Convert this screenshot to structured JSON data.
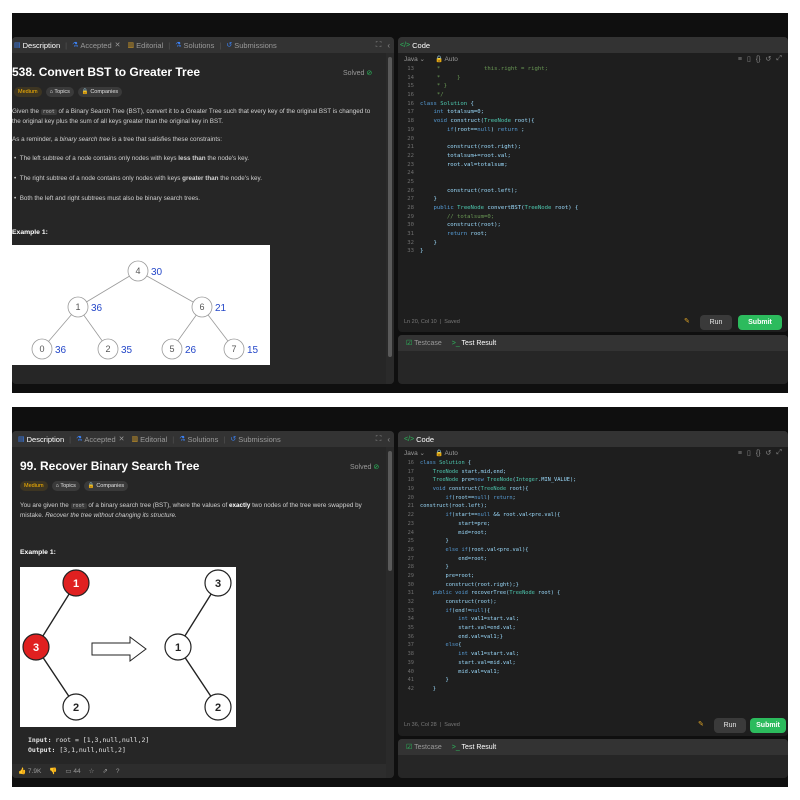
{
  "shots": [
    {
      "tabs": {
        "description": "Description",
        "accepted": "Accepted",
        "editorial": "Editorial",
        "solutions": "Solutions",
        "submissions": "Submissions"
      },
      "problem": {
        "title": "538. Convert BST to Greater Tree",
        "status": "Solved",
        "difficulty": "Medium",
        "topics": "Topics",
        "companies": "Companies",
        "p1a": "Given the",
        "p1code": "root",
        "p1b": "of a Binary Search Tree (BST), convert it to a Greater Tree such that every key of the original BST is changed to the original key plus the sum of all keys greater than the original key in BST.",
        "p2a": "As a reminder, a",
        "p2em": "binary search tree",
        "p2b": "is a tree that satisfies these constraints:",
        "b1a": "The left subtree of a node contains only nodes with keys",
        "b1b": "less than",
        "b1c": "the node's key.",
        "b2a": "The right subtree of a node contains only nodes with keys",
        "b2b": "greater than",
        "b2c": "the node's key.",
        "b3": "Both the left and right subtrees must also be binary search trees.",
        "example": "Example 1:"
      },
      "tree": {
        "nodes": [
          {
            "v": "4",
            "sum": "30"
          },
          {
            "v": "1",
            "sum": "36"
          },
          {
            "v": "6",
            "sum": "21"
          },
          {
            "v": "0",
            "sum": "36"
          },
          {
            "v": "2",
            "sum": "35"
          },
          {
            "v": "5",
            "sum": "26"
          },
          {
            "v": "7",
            "sum": "15"
          }
        ]
      },
      "editor": {
        "header": "Code",
        "lang": "Java",
        "mode": "Auto",
        "cursor": "Ln 20, Col 10",
        "saved": "Saved",
        "run": "Run",
        "submit": "Submit",
        "testcase": "Testcase",
        "testresult": "Test Result",
        "lines": [
          {
            "n": "13",
            "t": "     *             this.right = right;"
          },
          {
            "n": "14",
            "t": "     *     }"
          },
          {
            "n": "15",
            "t": "     * }"
          },
          {
            "n": "16",
            "t": "     */"
          },
          {
            "n": "16",
            "t": "class Solution {"
          },
          {
            "n": "17",
            "t": "    int totalsum=0;"
          },
          {
            "n": "18",
            "t": "    void construct(TreeNode root){"
          },
          {
            "n": "19",
            "t": "        if(root==null) return ;"
          },
          {
            "n": "20",
            "t": ""
          },
          {
            "n": "21",
            "t": "        construct(root.right);"
          },
          {
            "n": "22",
            "t": "        totalsum+=root.val;"
          },
          {
            "n": "23",
            "t": "        root.val=totalsum;"
          },
          {
            "n": "24",
            "t": ""
          },
          {
            "n": "25",
            "t": ""
          },
          {
            "n": "26",
            "t": "        construct(root.left);"
          },
          {
            "n": "27",
            "t": "    }"
          },
          {
            "n": "28",
            "t": "    public TreeNode convertBST(TreeNode root) {"
          },
          {
            "n": "29",
            "t": "        // totalsum=0;"
          },
          {
            "n": "30",
            "t": "        construct(root);"
          },
          {
            "n": "31",
            "t": "        return root;"
          },
          {
            "n": "32",
            "t": "    }"
          },
          {
            "n": "33",
            "t": "}"
          }
        ]
      }
    },
    {
      "tabs": {
        "description": "Description",
        "accepted": "Accepted",
        "editorial": "Editorial",
        "solutions": "Solutions",
        "submissions": "Submissions"
      },
      "problem": {
        "title": "99. Recover Binary Search Tree",
        "status": "Solved",
        "difficulty": "Medium",
        "topics": "Topics",
        "companies": "Companies",
        "p1a": "You are given the",
        "p1code": "root",
        "p1b": "of a binary search tree (BST), where the values of",
        "p1bold": "exactly",
        "p1c": "two nodes of the tree were swapped by mistake.",
        "p1em": "Recover the tree without changing its structure.",
        "example": "Example 1:",
        "input_label": "Input:",
        "input_value": "root = [1,3,null,null,2]",
        "output_label": "Output:",
        "output_value": "[3,1,null,null,2]",
        "likes": "7.9K",
        "comments": "44"
      },
      "tree": {
        "before": [
          "1",
          "3",
          "2"
        ],
        "after": [
          "3",
          "1",
          "2"
        ]
      },
      "editor": {
        "header": "Code",
        "lang": "Java",
        "mode": "Auto",
        "cursor": "Ln 36, Col 28",
        "saved": "Saved",
        "run": "Run",
        "submit": "Submit",
        "testcase": "Testcase",
        "testresult": "Test Result",
        "lines": [
          {
            "n": "16",
            "t": "class Solution {"
          },
          {
            "n": "17",
            "t": "    TreeNode start,mid,end;"
          },
          {
            "n": "18",
            "t": "    TreeNode pre=new TreeNode(Integer.MIN_VALUE);"
          },
          {
            "n": "19",
            "t": "    void construct(TreeNode root){"
          },
          {
            "n": "20",
            "t": "        if(root==null) return;"
          },
          {
            "n": "21",
            "t": "construct(root.left);"
          },
          {
            "n": "22",
            "t": "        if(start==null && root.val<pre.val){"
          },
          {
            "n": "23",
            "t": "            start=pre;"
          },
          {
            "n": "24",
            "t": "            mid=root;"
          },
          {
            "n": "25",
            "t": "        }"
          },
          {
            "n": "26",
            "t": "        else if(root.val<pre.val){"
          },
          {
            "n": "27",
            "t": "            end=root;"
          },
          {
            "n": "28",
            "t": "        }"
          },
          {
            "n": "29",
            "t": "        pre=root;"
          },
          {
            "n": "30",
            "t": "        construct(root.right);}"
          },
          {
            "n": "31",
            "t": "    public void recoverTree(TreeNode root) {"
          },
          {
            "n": "32",
            "t": "        construct(root);"
          },
          {
            "n": "33",
            "t": "        if(end!=null){"
          },
          {
            "n": "34",
            "t": "            int val1=start.val;"
          },
          {
            "n": "35",
            "t": "            start.val=end.val;"
          },
          {
            "n": "36",
            "t": "            end.val=val1;}"
          },
          {
            "n": "37",
            "t": "        else{"
          },
          {
            "n": "38",
            "t": "            int val1=start.val;"
          },
          {
            "n": "39",
            "t": "            start.val=mid.val;"
          },
          {
            "n": "40",
            "t": "            mid.val=val1;"
          },
          {
            "n": "41",
            "t": "        }"
          },
          {
            "n": "42",
            "t": "    }"
          }
        ]
      }
    }
  ],
  "colors": {
    "accent_green": "#2cbb5d",
    "medium": "#ffb800",
    "node_red": "#e02020",
    "sum_blue": "#2346c8"
  },
  "icons": [
    "description-icon",
    "flask-icon",
    "book-icon",
    "beaker-icon",
    "history-icon",
    "code-icon",
    "lock-icon",
    "check-circle-icon",
    "tag-icon",
    "gear-icon",
    "bookmark-icon",
    "braces-icon",
    "undo-icon",
    "expand-icon",
    "thumbs-up-icon",
    "thumbs-down-icon",
    "comment-icon",
    "star-icon",
    "share-icon",
    "help-icon",
    "checkbox-icon",
    "terminal-icon"
  ]
}
